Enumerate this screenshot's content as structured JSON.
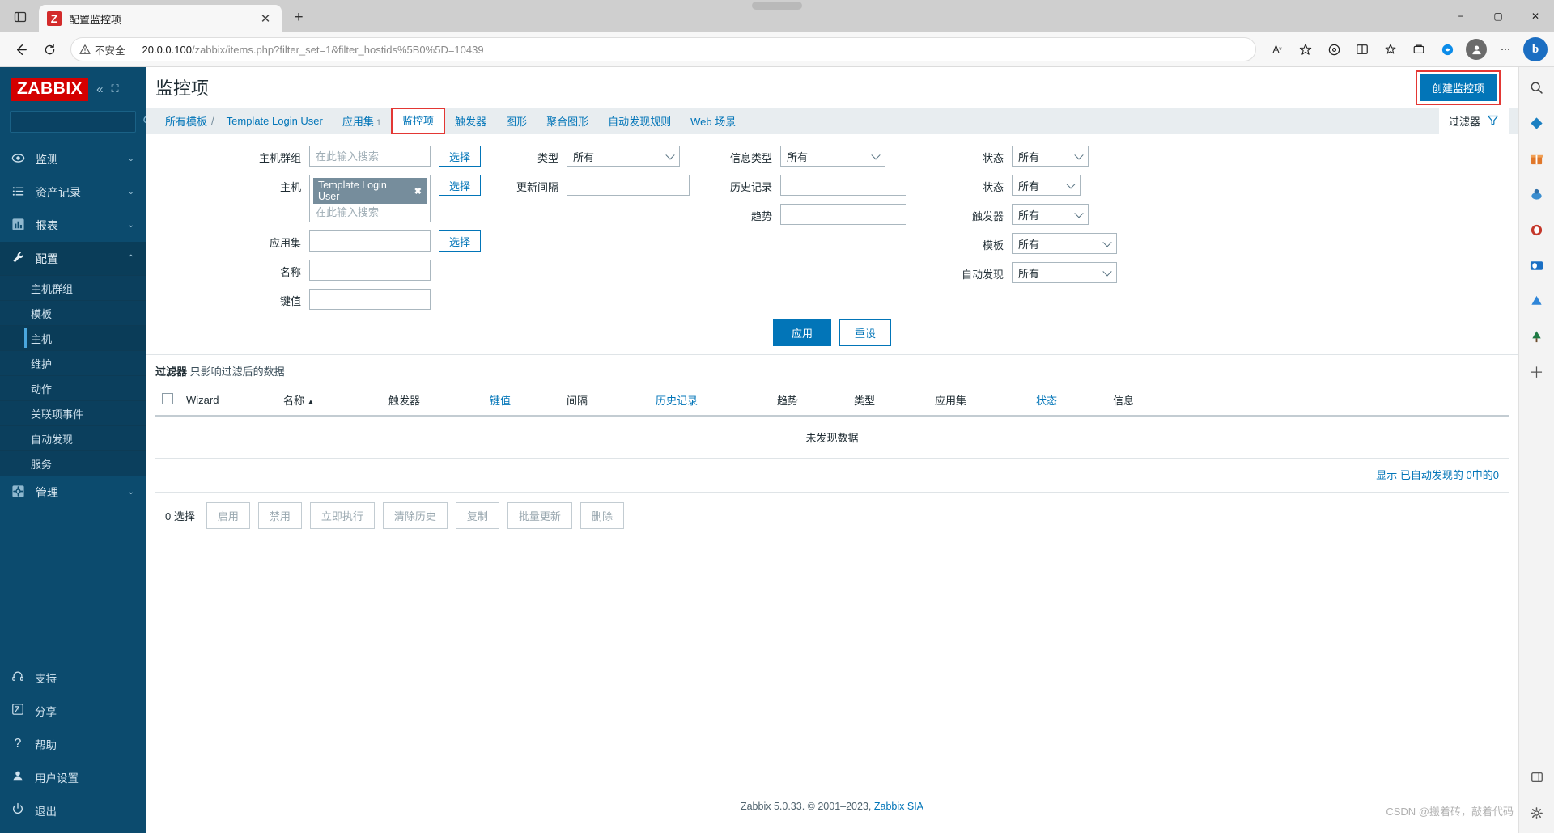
{
  "browser": {
    "tab": {
      "favicon_letter": "Z",
      "title": "配置监控项",
      "close_icon": "close-icon"
    },
    "new_tab_label": "+",
    "security_label": "不安全",
    "url_host": "20.0.0.100",
    "url_path": "/zabbix/items.php?filter_set=1&filter_hostids%5B0%5D=10439",
    "window": {
      "minimize": "−",
      "maximize": "▢",
      "close": "✕"
    },
    "bing_label": "b"
  },
  "sidebar": {
    "logo": "ZABBIX",
    "search_placeholder": "",
    "collapse_icon": "chevron-double-left-icon",
    "expand_icon": "expand-icon",
    "nav": [
      {
        "label": "监测",
        "icon": "eye-icon",
        "chevron": "⌄",
        "active": false
      },
      {
        "label": "资产记录",
        "icon": "list-icon",
        "chevron": "⌄",
        "active": false
      },
      {
        "label": "报表",
        "icon": "chart-icon",
        "chevron": "⌄",
        "active": false
      },
      {
        "label": "配置",
        "icon": "wrench-icon",
        "chevron": "⌃",
        "active": true
      }
    ],
    "sub_items": [
      {
        "label": "主机群组",
        "selected": false
      },
      {
        "label": "模板",
        "selected": false
      },
      {
        "label": "主机",
        "selected": true
      },
      {
        "label": "维护",
        "selected": false
      },
      {
        "label": "动作",
        "selected": false
      },
      {
        "label": "关联项事件",
        "selected": false
      },
      {
        "label": "自动发现",
        "selected": false
      },
      {
        "label": "服务",
        "selected": false
      }
    ],
    "admin": {
      "label": "管理",
      "icon": "gear-icon",
      "chevron": "⌄"
    },
    "footer": [
      {
        "label": "支持",
        "icon": "headset-icon"
      },
      {
        "label": "分享",
        "icon": "share-icon"
      },
      {
        "label": "帮助",
        "icon": "question-icon"
      },
      {
        "label": "用户设置",
        "icon": "user-icon"
      },
      {
        "label": "退出",
        "icon": "power-icon"
      }
    ]
  },
  "header": {
    "title": "监控项",
    "create_button": "创建监控项"
  },
  "breadcrumb": {
    "all_templates": "所有模板",
    "separator": "/",
    "template_name": "Template Login User",
    "tabs": [
      {
        "label": "应用集",
        "count": "1",
        "active": false
      },
      {
        "label": "监控项",
        "count": "",
        "active": true
      },
      {
        "label": "触发器",
        "count": "",
        "active": false
      },
      {
        "label": "图形",
        "count": "",
        "active": false
      },
      {
        "label": "聚合图形",
        "count": "",
        "active": false
      },
      {
        "label": "自动发现规则",
        "count": "",
        "active": false
      },
      {
        "label": "Web 场景",
        "count": "",
        "active": false
      }
    ],
    "filter_tab": "过滤器",
    "filter_icon": "funnel-icon"
  },
  "filter": {
    "col1": [
      {
        "label": "主机群组",
        "type": "multiselect",
        "placeholder": "在此输入搜索",
        "chips": [],
        "button": "选择"
      },
      {
        "label": "主机",
        "type": "multiselect",
        "placeholder": "在此输入搜索",
        "chips": [
          "Template Login User"
        ],
        "button": "选择"
      },
      {
        "label": "应用集",
        "type": "input",
        "value": "",
        "button": "选择"
      },
      {
        "label": "名称",
        "type": "input",
        "value": "",
        "button": ""
      },
      {
        "label": "键值",
        "type": "input",
        "value": "",
        "button": ""
      }
    ],
    "col2": [
      {
        "label": "类型",
        "type": "select",
        "value": "所有"
      },
      {
        "label": "更新间隔",
        "type": "input",
        "value": ""
      }
    ],
    "col3": [
      {
        "label": "信息类型",
        "type": "select",
        "value": "所有"
      },
      {
        "label": "历史记录",
        "type": "input",
        "value": ""
      },
      {
        "label": "趋势",
        "type": "input",
        "value": ""
      }
    ],
    "col4": [
      {
        "label": "状态",
        "type": "select",
        "value": "所有"
      },
      {
        "label": "状态",
        "type": "select",
        "value": "所有"
      },
      {
        "label": "触发器",
        "type": "select",
        "value": "所有"
      },
      {
        "label": "模板",
        "type": "select",
        "value": "所有"
      },
      {
        "label": "自动发现",
        "type": "select",
        "value": "所有"
      }
    ],
    "apply": "应用",
    "reset": "重设",
    "note_strong": "过滤器",
    "note_rest": "只影响过滤后的数据"
  },
  "table": {
    "columns": [
      {
        "label": "Wizard",
        "link": false,
        "sorted": false
      },
      {
        "label": "名称",
        "link": false,
        "sorted": true,
        "arrow": "▲"
      },
      {
        "label": "触发器",
        "link": false,
        "sorted": false
      },
      {
        "label": "键值",
        "link": true,
        "sorted": false
      },
      {
        "label": "间隔",
        "link": false,
        "sorted": false
      },
      {
        "label": "历史记录",
        "link": true,
        "sorted": false
      },
      {
        "label": "趋势",
        "link": false,
        "sorted": false
      },
      {
        "label": "类型",
        "link": false,
        "sorted": false
      },
      {
        "label": "应用集",
        "link": false,
        "sorted": false
      },
      {
        "label": "状态",
        "link": true,
        "sorted": false
      },
      {
        "label": "信息",
        "link": false,
        "sorted": false
      }
    ],
    "empty_message": "未发现数据",
    "count_prefix": "显示",
    "count_text": "已自动发现的 0中的0"
  },
  "actions": {
    "selected_label": "0 选择",
    "buttons": [
      "启用",
      "禁用",
      "立即执行",
      "清除历史",
      "复制",
      "批量更新",
      "删除"
    ]
  },
  "footer": {
    "text": "Zabbix 5.0.33. © 2001–2023,",
    "link": "Zabbix SIA"
  },
  "watermark": "CSDN @搬着砖，敲着代码",
  "edge_rail": [
    {
      "name": "search-icon",
      "glyph": "🔍"
    },
    {
      "name": "shopping-icon",
      "glyph": "◈"
    },
    {
      "name": "gift-icon",
      "glyph": "▤"
    },
    {
      "name": "games-icon",
      "glyph": "♟"
    },
    {
      "name": "office-icon",
      "glyph": "◍"
    },
    {
      "name": "outlook-icon",
      "glyph": "◎"
    },
    {
      "name": "drop-icon",
      "glyph": "◭"
    },
    {
      "name": "tree-icon",
      "glyph": "♣"
    },
    {
      "name": "add-icon",
      "glyph": "＋"
    }
  ],
  "colors": {
    "zabbix_blue": "#0275b8",
    "sidebar_bg": "#0c4b6e",
    "logo_red": "#d40000",
    "highlight_red": "#e33734"
  }
}
